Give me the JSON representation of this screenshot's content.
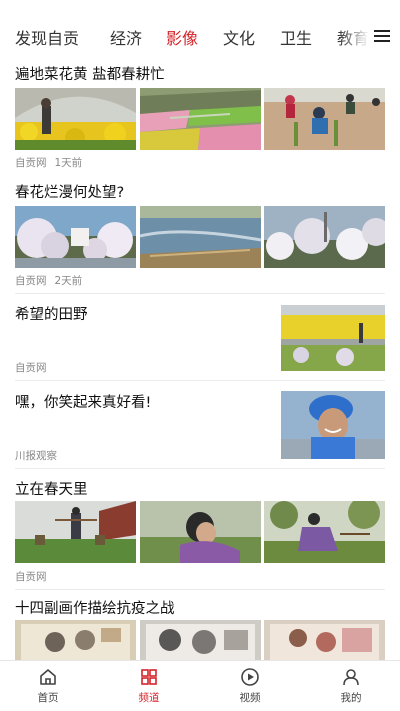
{
  "tabs": [
    {
      "label": "发现自贡",
      "active": false
    },
    {
      "label": "经济",
      "active": false
    },
    {
      "label": "影像",
      "active": true
    },
    {
      "label": "文化",
      "active": false
    },
    {
      "label": "卫生",
      "active": false
    },
    {
      "label": "教育",
      "active": false
    }
  ],
  "menu_icon": "hamburger-menu-icon",
  "feed": [
    {
      "title": "遍地菜花黄 盐都春耕忙",
      "source": "自贡网",
      "time": "1天前"
    },
    {
      "title": "春花烂漫何处望?",
      "source": "自贡网",
      "time": "2天前"
    },
    {
      "title": "希望的田野",
      "source": "自贡网",
      "time": ""
    },
    {
      "title": "嘿，你笑起来真好看!",
      "source": "川报观察",
      "time": ""
    },
    {
      "title": "立在春天里",
      "source": "自贡网",
      "time": ""
    },
    {
      "title": "十四副画作描绘抗疫之战",
      "source": "",
      "time": ""
    }
  ],
  "bottom_nav": [
    {
      "label": "首页",
      "icon": "home-icon",
      "active": false
    },
    {
      "label": "频道",
      "icon": "channels-grid-icon",
      "active": true
    },
    {
      "label": "视频",
      "icon": "video-play-icon",
      "active": false
    },
    {
      "label": "我的",
      "icon": "user-profile-icon",
      "active": false
    }
  ],
  "colors": {
    "accent": "#d4232a",
    "text": "#222222",
    "meta": "#888888"
  }
}
